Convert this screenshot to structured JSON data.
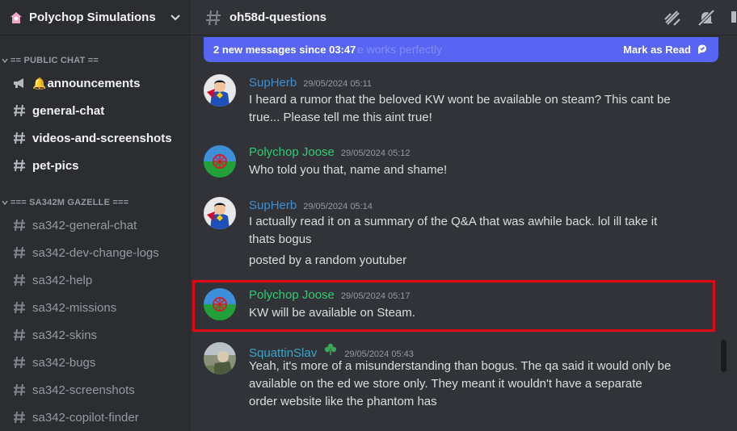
{
  "server": {
    "name": "Polychop Simulations"
  },
  "sidebar": {
    "categories": [
      {
        "label": "== PUBLIC CHAT =="
      },
      {
        "label": "=== SA342M GAZELLE ==="
      }
    ],
    "channels": [
      {
        "label": "announcements",
        "prefix": "🔔"
      },
      {
        "label": "general-chat"
      },
      {
        "label": "videos-and-screenshots"
      },
      {
        "label": "pet-pics"
      },
      {
        "label": "sa342-general-chat"
      },
      {
        "label": "sa342-dev-change-logs"
      },
      {
        "label": "sa342-help"
      },
      {
        "label": "sa342-missions"
      },
      {
        "label": "sa342-skins"
      },
      {
        "label": "sa342-bugs"
      },
      {
        "label": "sa342-screenshots"
      },
      {
        "label": "sa342-copilot-finder"
      }
    ]
  },
  "channel": {
    "name": "oh58d-questions"
  },
  "new_messages": {
    "text": "2 new messages since 03:47",
    "action": "Mark as Read",
    "ghost_text": "e works perfectly"
  },
  "messages": [
    {
      "author": "SupHerb",
      "time": "29/05/2024 05:11",
      "lines": [
        "I heard a rumor that the beloved KW  wont be available on steam? This cant be",
        "true... Please tell me this aint true!"
      ]
    },
    {
      "author": "Polychop Joose",
      "time": "29/05/2024 05:12",
      "lines": [
        "Who told you that, name and shame!"
      ]
    },
    {
      "author": "SupHerb",
      "time": "29/05/2024 05:14",
      "lines": [
        "I actually read it on a summary of the Q&A that was awhile back. lol ill take it",
        "thats bogus"
      ],
      "followup": "posted by a random youtuber"
    },
    {
      "author": "Polychop Joose",
      "time": "29/05/2024 05:17",
      "lines": [
        "KW will be available on Steam."
      ]
    },
    {
      "author": "SquattinSlav",
      "time": "29/05/2024 05:43",
      "lines": [
        "Yeah, it's more of a misunderstanding than bogus. The qa said it would only be",
        "available on the ed we store only. They meant it wouldn't have a separate",
        "order website like the phantom has"
      ]
    }
  ],
  "colors": {
    "accent": "#5865f2",
    "highlight": "#e30613",
    "joose": "#2ecc71",
    "supherb": "#3e8ed0"
  }
}
